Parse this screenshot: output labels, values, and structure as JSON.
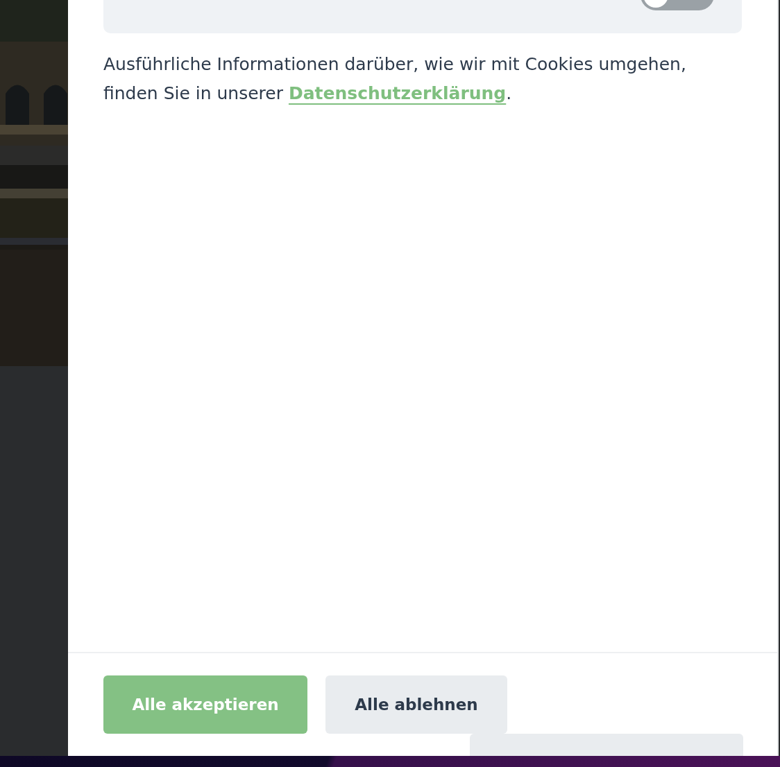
{
  "category": {
    "enabled": false
  },
  "info": {
    "text": "Ausführliche Informationen darüber, wie wir mit Cookies umgehen, finden Sie in unserer ",
    "link": "Datenschutzerklärung",
    "end": "."
  },
  "buttons": [
    {
      "label": "Alle akzeptieren",
      "kind": "primary"
    },
    {
      "label": "Alle ablehnen",
      "kind": "secondary"
    }
  ]
}
